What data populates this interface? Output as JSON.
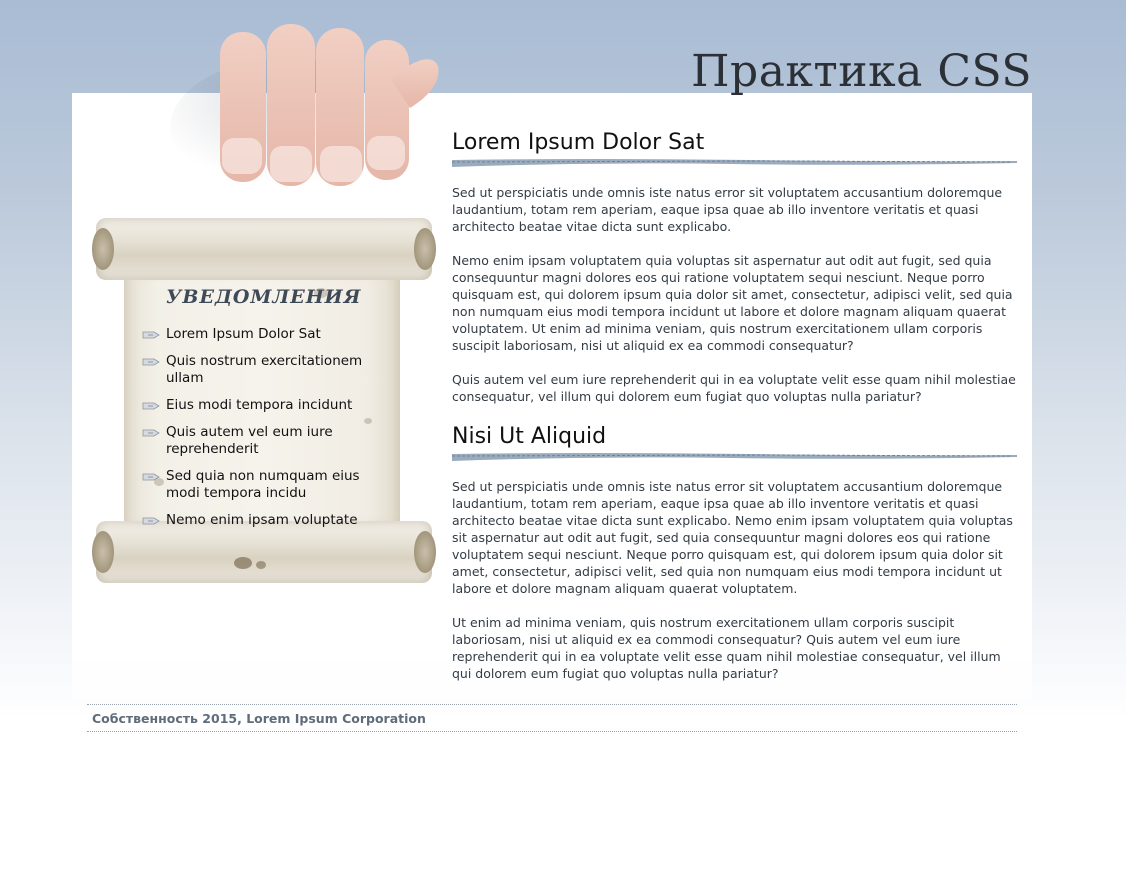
{
  "site": {
    "title": "Практика CSS"
  },
  "sidebar": {
    "title": "УВЕДОМЛЕНИЯ",
    "items": [
      {
        "label": "Lorem Ipsum Dolor Sat",
        "icon": "arrow-bullet-icon"
      },
      {
        "label": "Quis nostrum exercitationem ullam",
        "icon": "arrow-bullet-icon"
      },
      {
        "label": "Eius modi tempora incidunt",
        "icon": "arrow-bullet-icon"
      },
      {
        "label": "Quis autem vel eum iure reprehenderit",
        "icon": "arrow-bullet-icon"
      },
      {
        "label": "Sed quia non numquam eius modi tempora incidu",
        "icon": "arrow-bullet-icon"
      },
      {
        "label": "Nemo enim ipsam voluptate",
        "icon": "arrow-bullet-icon"
      }
    ]
  },
  "main": {
    "sections": [
      {
        "heading": "Lorem Ipsum Dolor Sat",
        "paragraphs": [
          "Sed ut perspiciatis unde omnis iste natus error sit voluptatem accusantium doloremque laudantium, totam rem aperiam, eaque ipsa quae ab illo inventore veritatis et quasi architecto beatae vitae dicta sunt explicabo.",
          "Nemo enim ipsam voluptatem quia voluptas sit aspernatur aut odit aut fugit, sed quia consequuntur magni dolores eos qui ratione voluptatem sequi nesciunt. Neque porro quisquam est, qui dolorem ipsum quia dolor sit amet, consectetur, adipisci velit, sed quia non numquam eius modi tempora incidunt ut labore et dolore magnam aliquam quaerat voluptatem. Ut enim ad minima veniam, quis nostrum exercitationem ullam corporis suscipit laboriosam, nisi ut aliquid ex ea commodi consequatur?",
          "Quis autem vel eum iure reprehenderit qui in ea voluptate velit esse quam nihil molestiae consequatur, vel illum qui dolorem eum fugiat quo voluptas nulla pariatur?"
        ]
      },
      {
        "heading": "Nisi Ut Aliquid",
        "paragraphs": [
          "Sed ut perspiciatis unde omnis iste natus error sit voluptatem accusantium doloremque laudantium, totam rem aperiam, eaque ipsa quae ab illo inventore veritatis et quasi architecto beatae vitae dicta sunt explicabo. Nemo enim ipsam voluptatem quia voluptas sit aspernatur aut odit aut fugit, sed quia consequuntur magni dolores eos qui ratione voluptatem sequi nesciunt. Neque porro quisquam est, qui dolorem ipsum quia dolor sit amet, consectetur, adipisci velit, sed quia non numquam eius modi tempora incidunt ut labore et dolore magnam aliquam quaerat voluptatem.",
          "Ut enim ad minima veniam, quis nostrum exercitationem ullam corporis suscipit laboriosam, nisi ut aliquid ex ea commodi consequatur? Quis autem vel eum iure reprehenderit qui in ea voluptate velit esse quam nihil molestiae consequatur, vel illum qui dolorem eum fugiat quo voluptas nulla pariatur?"
        ]
      }
    ]
  },
  "footer": {
    "copyright": "Собственность 2015, Lorem Ipsum Corporation"
  },
  "colors": {
    "background_top": "#a9bcd4",
    "page_background": "#ffffff",
    "heading_text": "#111111",
    "body_text": "#333b44",
    "brush_accent": "#8fa0b3",
    "footer_text": "#5f6c7a"
  }
}
